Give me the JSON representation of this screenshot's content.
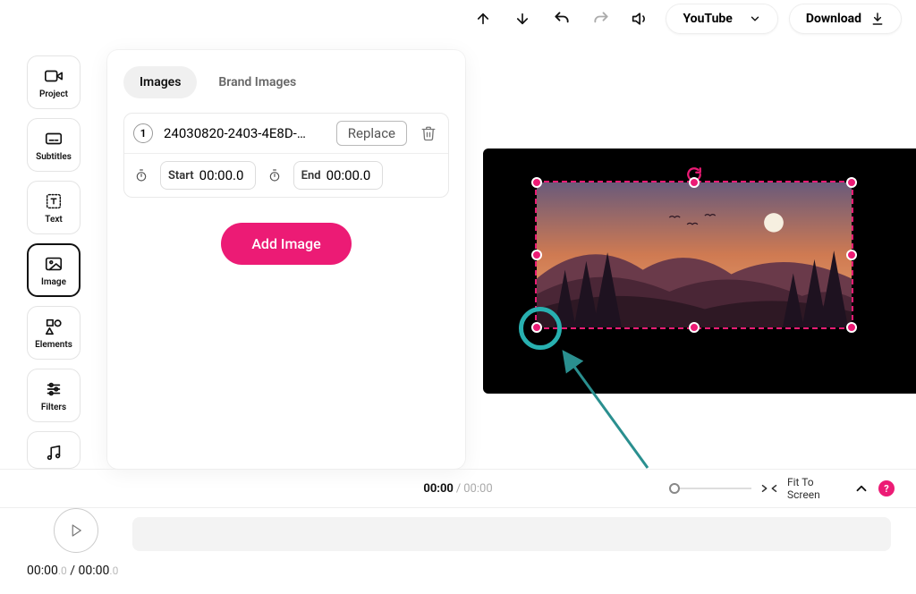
{
  "topbar": {
    "platform": "YouTube",
    "download": "Download"
  },
  "rail": {
    "project": "Project",
    "subtitles": "Subtitles",
    "text": "Text",
    "image": "Image",
    "elements": "Elements",
    "filters": "Filters"
  },
  "panel": {
    "tabs": {
      "images": "Images",
      "brand": "Brand Images"
    },
    "item": {
      "index": "1",
      "filename": "24030820-2403-4E8D-…",
      "replace": "Replace",
      "start_label": "Start",
      "start_value": "00:00.0",
      "end_label": "End",
      "end_value": "00:00.0"
    },
    "add_button": "Add Image"
  },
  "status": {
    "current": "00:00",
    "total": "00:00",
    "fit": "Fit To Screen",
    "help": "?"
  },
  "play": {
    "cur_main": "00:00",
    "cur_ms": ".0",
    "sep": " / ",
    "tot_main": "00:00",
    "tot_ms": ".0"
  }
}
